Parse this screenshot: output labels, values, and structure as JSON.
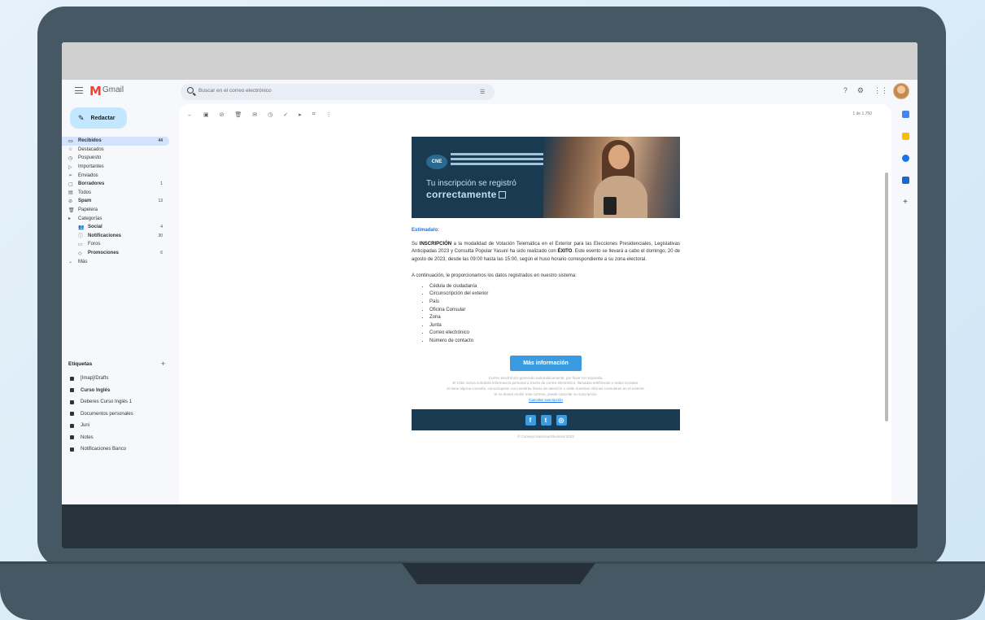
{
  "app": {
    "name": "Gmail",
    "search_placeholder": "Buscar en el correo electrónico"
  },
  "compose_label": "Redactar",
  "nav": [
    {
      "icon": "inbox-icon",
      "glyph": "▭",
      "label": "Recibidos",
      "count": "44",
      "active": true
    },
    {
      "icon": "star-icon",
      "glyph": "☆",
      "label": "Destacados"
    },
    {
      "icon": "clock-icon",
      "glyph": "◷",
      "label": "Pospuesto"
    },
    {
      "icon": "important-icon",
      "glyph": "▷",
      "label": "Importantes"
    },
    {
      "icon": "send-icon",
      "glyph": "➢",
      "label": "Enviados"
    },
    {
      "icon": "draft-icon",
      "glyph": "▢",
      "label": "Borradores",
      "bold": true,
      "count": "1"
    },
    {
      "icon": "all-mail-icon",
      "glyph": "▤",
      "label": "Todos"
    },
    {
      "icon": "spam-icon",
      "glyph": "⊘",
      "label": "Spam",
      "bold": true,
      "count": "13"
    },
    {
      "icon": "trash-icon",
      "glyph": "🗑",
      "label": "Papelera"
    },
    {
      "icon": "categories-icon",
      "glyph": "▸",
      "label": "Categorías"
    },
    {
      "icon": "social-icon",
      "glyph": "👥",
      "label": "Social",
      "sub": true,
      "bold": true,
      "count": "4"
    },
    {
      "icon": "notifications-icon",
      "glyph": "ⓘ",
      "label": "Notificaciones",
      "sub": true,
      "bold": true,
      "count": "30"
    },
    {
      "icon": "forums-icon",
      "glyph": "▭",
      "label": "Foros",
      "sub": true
    },
    {
      "icon": "promotions-icon",
      "glyph": "◇",
      "label": "Promociones",
      "sub": true,
      "bold": true,
      "count": "6"
    },
    {
      "icon": "chevron-down-icon",
      "glyph": "⌄",
      "label": "Más"
    }
  ],
  "labels_heading": "Etiquetas",
  "labels": [
    {
      "label": "[Imap]/Drafts"
    },
    {
      "label": "Curso Inglés",
      "bold": true
    },
    {
      "label": "Deberes Curso Inglés 1"
    },
    {
      "label": "Documentos personales"
    },
    {
      "label": "Juni"
    },
    {
      "label": "Notes"
    },
    {
      "label": "Notificaciones Banco"
    }
  ],
  "toolbar": {
    "pager": "1 de 1.750"
  },
  "email": {
    "banner_line1": "Tu inscripción se registró",
    "banner_line2": "correctamente",
    "logo_text": "CNE",
    "greeting": "Estimada/o:",
    "para_intro_1": "Su ",
    "para_bold_1": "INSCRIPCIÓN",
    "para_intro_2": " a la modalidad de Votación Telemática en el Exterior para las Elecciones Presidenciales, Legislativas Anticipadas 2023 y Consulta Popular Yasuní ha sido realizado con ",
    "para_bold_2": "ÉXITO",
    "para_intro_3": ". Este evento se llevará a cabo el domingo, 20 de agosto de 2023, desde las 09:00 hasta las 15:00, según el huso horario correspondiente a su zona electoral.",
    "para2": "A continuación, le proporcionamos los datos registrados en nuestro sistema:",
    "data_items": [
      "Cédula de ciudadanía",
      "Circunscripción del exterior",
      "País",
      "Oficina Consular",
      "Zona",
      "Junta",
      "Correo electrónico",
      "Número de contacto"
    ],
    "cta_label": "Más información",
    "fineprint": [
      "Correo electrónico generado automáticamente, por favor no responda.",
      "El CNE nunca solicitará información personal a través de correo electrónico, llamadas telefónicas o redes sociales.",
      "Si tiene alguna consulta, comuníquese con nuestras líneas de atención o visite nuestras oficinas consulares en el exterior.",
      "Si no desea recibir más correos, puede cancelar su suscripción.",
      "Cancelar suscripción"
    ],
    "copyright": "© Consejo Nacional Electoral 2023"
  },
  "colors": {
    "accent": "#3b9be0",
    "banner_bg": "#1a3a52",
    "laptop": "#465864"
  }
}
